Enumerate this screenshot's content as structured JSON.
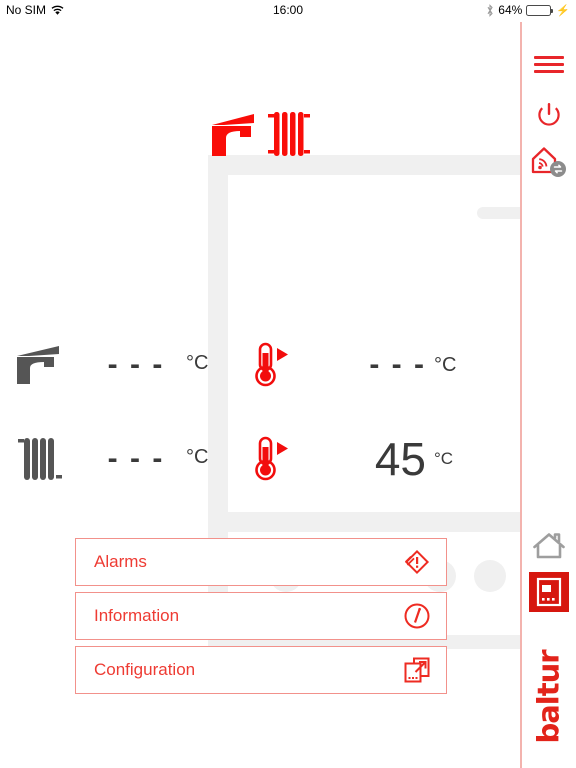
{
  "status_bar": {
    "carrier": "No SIM",
    "wifi_icon": "wifi-icon",
    "time": "16:00",
    "bluetooth_icon": "bluetooth-icon",
    "battery_percent": "64%",
    "battery_level": 64,
    "charging_icon": "lightning-bolt-icon",
    "battery_color": "#4cd964"
  },
  "sidebar": {
    "menu_icon": "hamburger-menu-icon",
    "power_icon": "power-icon",
    "network_icon": "home-wifi-sync-icon",
    "home_icon": "home-outline-icon",
    "panel_icon": "control-panel-icon",
    "logo_text": "baltur",
    "brand_color": "#e2231a",
    "accent_color": "#e8262a"
  },
  "schematic": {
    "faucet_icon": "faucet-icon-red",
    "radiator_icon": "radiator-icon-red",
    "pipe_color": "#f0f0f0"
  },
  "readouts": [
    {
      "source_icon": "faucet-icon",
      "value": "- - -",
      "unit": "°C",
      "setpoint_icon": "thermometer-arrow-icon",
      "setpoint_value": "- - -",
      "setpoint_unit": "°C"
    },
    {
      "source_icon": "radiator-icon",
      "value": "- - -",
      "unit": "°C",
      "setpoint_icon": "thermometer-arrow-icon",
      "setpoint_value": "45",
      "setpoint_unit": "°C"
    }
  ],
  "menu": [
    {
      "label": "Alarms",
      "icon": "alarm-warning-diamond-icon"
    },
    {
      "label": "Information",
      "icon": "information-circle-icon"
    },
    {
      "label": "Configuration",
      "icon": "configuration-external-icon"
    }
  ]
}
